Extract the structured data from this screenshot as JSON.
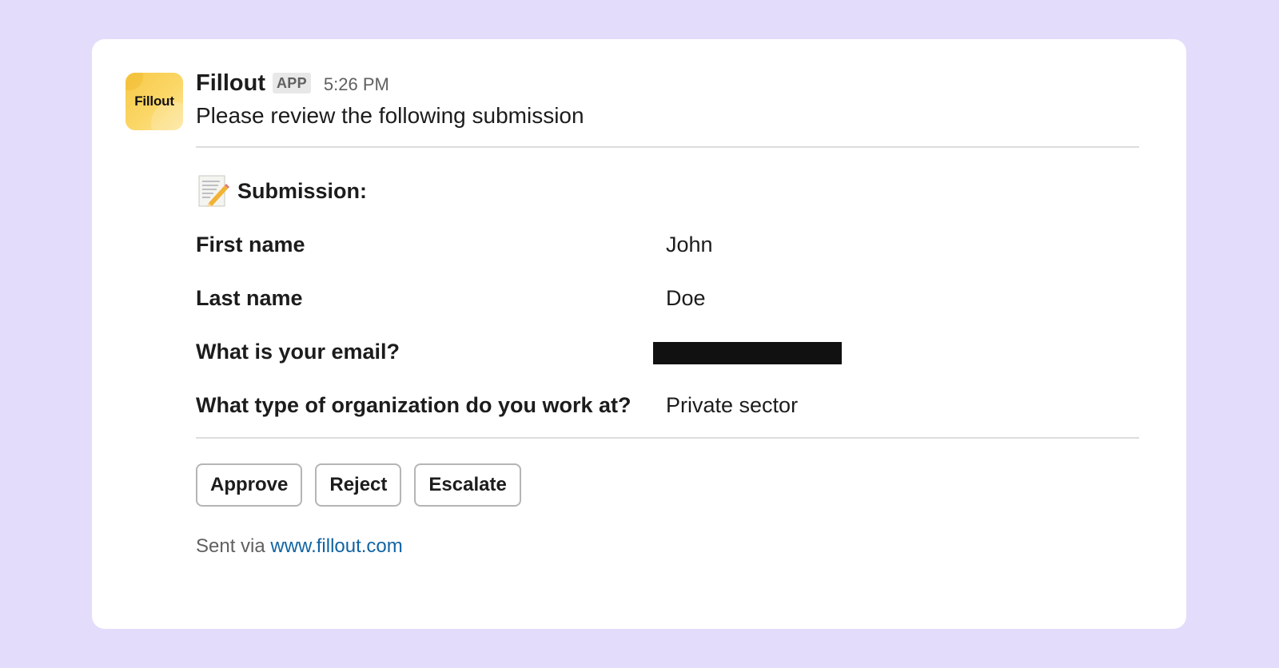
{
  "message": {
    "sender": "Fillout",
    "app_badge": "APP",
    "time": "5:26 PM",
    "intro": "Please review the following submission",
    "avatar_text": "Fillout"
  },
  "submission": {
    "heading": "Submission:",
    "heading_icon": "memo-icon",
    "fields": [
      {
        "label": "First name",
        "value": "John"
      },
      {
        "label": "Last name",
        "value": "Doe"
      },
      {
        "label": "What is your email?",
        "value": ""
      },
      {
        "label": "What type of organization do you work at?",
        "value": "Private sector"
      }
    ]
  },
  "actions": {
    "approve": "Approve",
    "reject": "Reject",
    "escalate": "Escalate"
  },
  "footer": {
    "prefix": "Sent via ",
    "link_text": "www.fillout.com"
  },
  "colors": {
    "background": "#e3dcfb",
    "card": "#ffffff",
    "link": "#1264a3",
    "avatar": "#f7c948"
  }
}
